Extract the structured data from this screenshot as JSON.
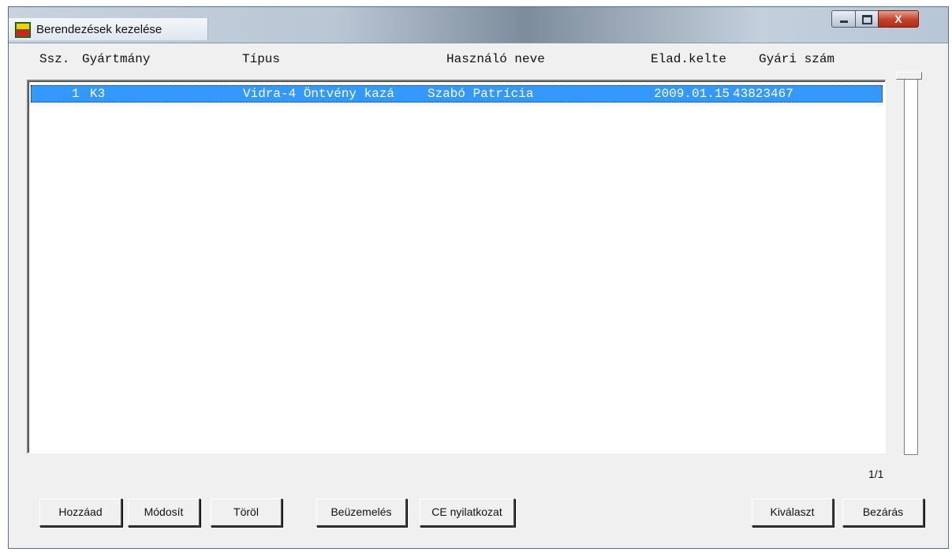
{
  "window": {
    "title": "Berendezések kezelése",
    "controls": {
      "minimize": "minimize-icon",
      "maximize": "maximize-icon",
      "close": "X"
    }
  },
  "table": {
    "columns": [
      "Ssz.",
      "Gyártmány",
      "Típus",
      "Használó neve",
      "Elad.kelte",
      "Gyári szám"
    ],
    "rows": [
      {
        "ssz": "1",
        "gyartmany": "K3",
        "tipus": "Vidra-4 Öntvény kazá",
        "hasznalo": "Szabó Patrícia",
        "elad_kelte": "2009.01.15",
        "gyari_szam": "43823467",
        "selected": true
      }
    ]
  },
  "pagination": "1/1",
  "buttons": {
    "add": "Hozzáad",
    "modify": "Módosít",
    "delete": "Töröl",
    "commissioning": "Beüzemelés",
    "ce": "CE nyilatkozat",
    "select": "Kiválaszt",
    "close": "Bezárás"
  },
  "colors": {
    "selection": "#3399ff",
    "titlebar": "#b9c6d4",
    "close_button": "#c4402b"
  }
}
